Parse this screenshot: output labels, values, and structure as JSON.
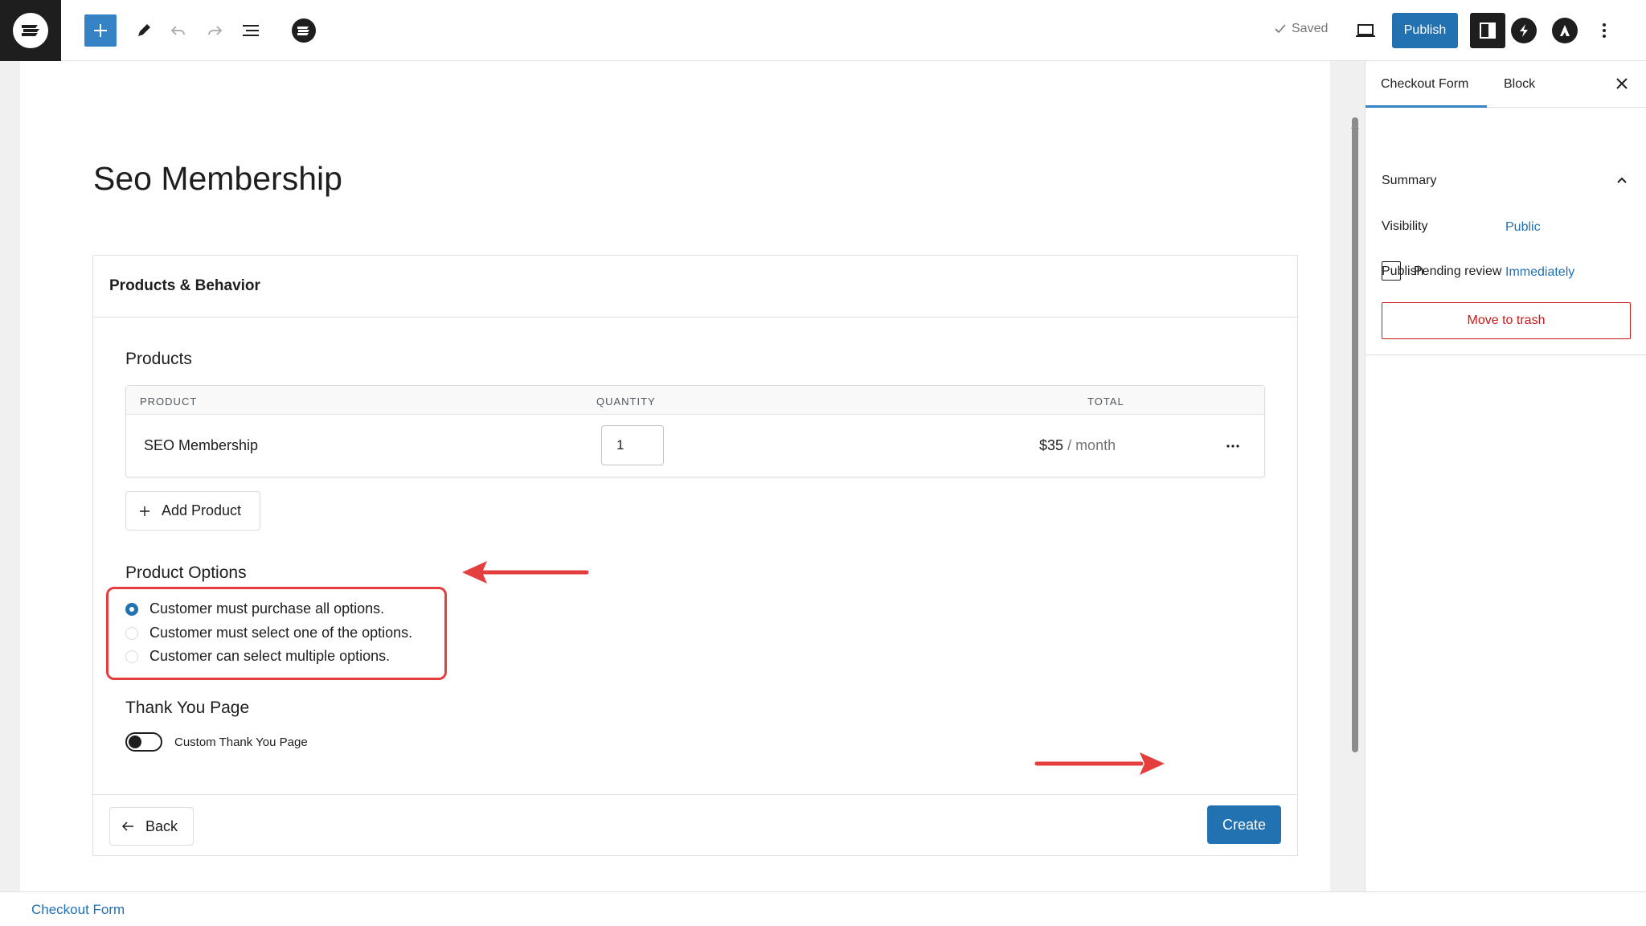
{
  "topbar": {
    "saved_label": "Saved",
    "publish_label": "Publish"
  },
  "page": {
    "title": "Seo Membership"
  },
  "card": {
    "header": "Products & Behavior",
    "products_title": "Products",
    "table": {
      "columns": [
        "PRODUCT",
        "QUANTITY",
        "TOTAL"
      ],
      "rows": [
        {
          "product": "SEO Membership",
          "quantity": "1",
          "total_amount": "$35",
          "total_period": "/ month"
        }
      ]
    },
    "add_product_label": "Add Product",
    "options_title": "Product Options",
    "options": [
      {
        "label": "Customer must purchase all options.",
        "selected": true
      },
      {
        "label": "Customer must select one of the options.",
        "selected": false
      },
      {
        "label": "Customer can select multiple options.",
        "selected": false
      }
    ],
    "thank_you_title": "Thank You Page",
    "thank_you_toggle_label": "Custom Thank You Page",
    "back_label": "Back",
    "create_label": "Create"
  },
  "sidebar": {
    "tabs": [
      "Checkout Form",
      "Block"
    ],
    "panel_title": "Summary",
    "visibility_label": "Visibility",
    "visibility_value": "Public",
    "publish_label": "Publish",
    "publish_value": "Immediately",
    "pending_review_label": "Pending review",
    "trash_label": "Move to trash"
  },
  "footer": {
    "breadcrumb": "Checkout Form"
  },
  "colors": {
    "accent": "#2271b1",
    "annotation": "#e53e3e",
    "danger": "#cc1818"
  }
}
